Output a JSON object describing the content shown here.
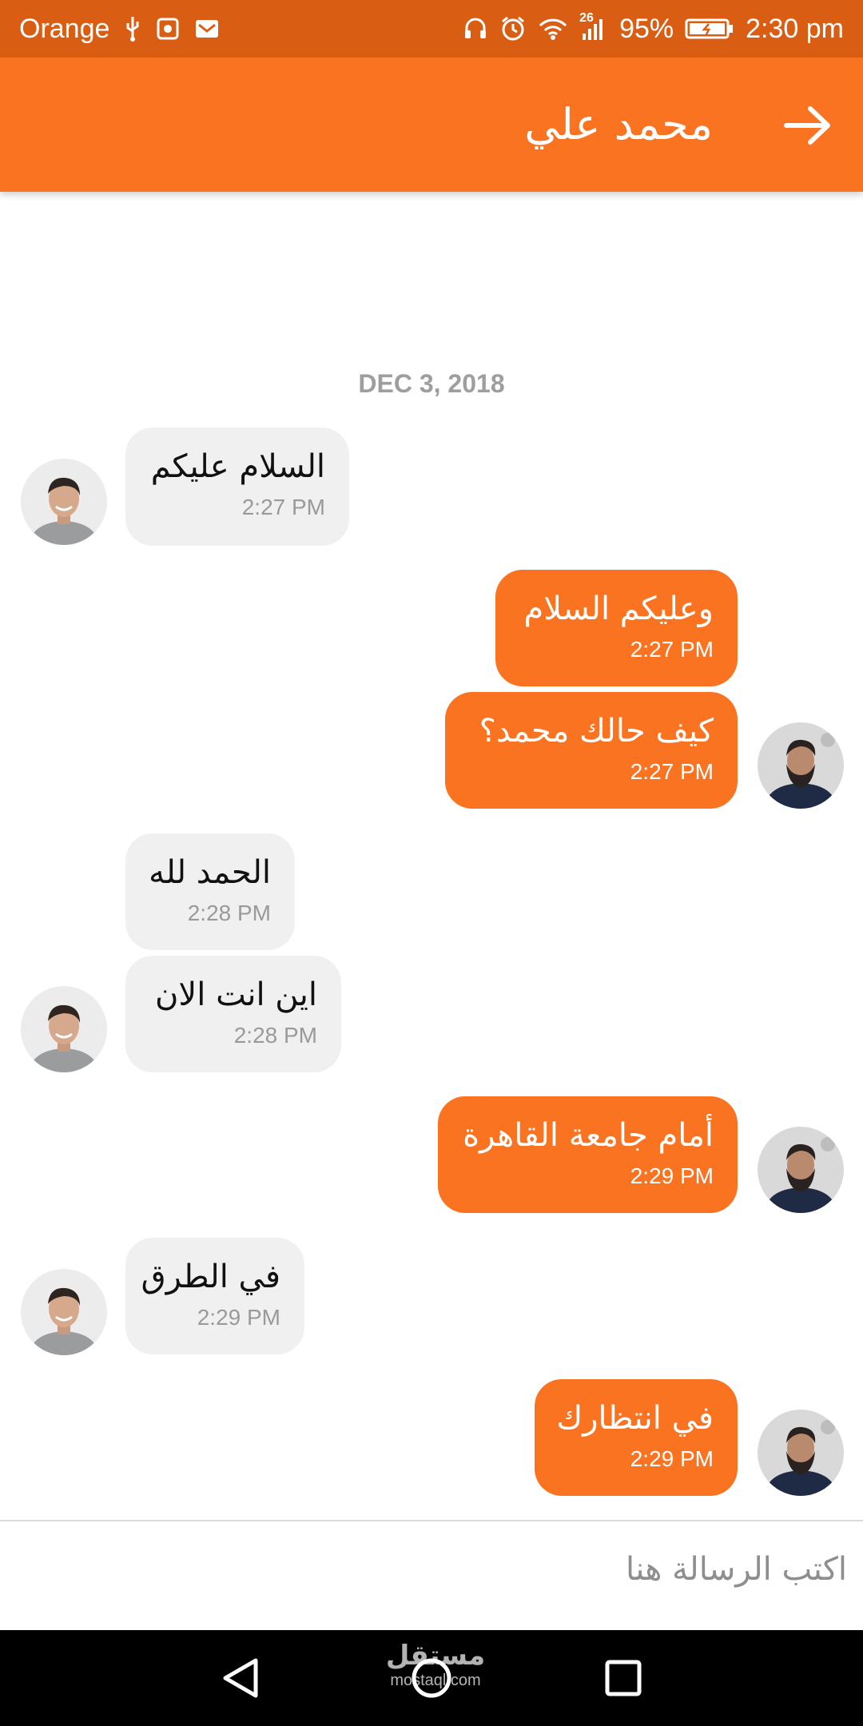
{
  "status_bar": {
    "carrier": "Orange",
    "network_label": "26",
    "battery": "95%",
    "time": "2:30 pm"
  },
  "header": {
    "contact_name": "محمد علي",
    "back_icon": "arrow-right-icon"
  },
  "conversation": {
    "date": "DEC 3, 2018",
    "messages": [
      {
        "direction": "incoming",
        "text": "السلام عليكم",
        "time": "2:27 PM"
      },
      {
        "direction": "outgoing",
        "text": "وعليكم السلام",
        "time": "2:27 PM"
      },
      {
        "direction": "outgoing",
        "text": "كيف حالك محمد؟",
        "time": "2:27 PM"
      },
      {
        "direction": "incoming",
        "text": "الحمد لله",
        "time": "2:28 PM"
      },
      {
        "direction": "incoming",
        "text": "اين انت الان",
        "time": "2:28 PM"
      },
      {
        "direction": "outgoing",
        "text": "أمام جامعة القاهرة",
        "time": "2:29 PM"
      },
      {
        "direction": "incoming",
        "text": "في الطرق",
        "time": "2:29 PM"
      },
      {
        "direction": "outgoing",
        "text": "في انتظارك",
        "time": "2:29 PM"
      }
    ]
  },
  "composer": {
    "placeholder": "اكتب الرسالة هنا",
    "value": ""
  },
  "watermark": {
    "arabic": "مستقل",
    "latin": "mostaql.com"
  },
  "colors": {
    "status_bar": "#d95e14",
    "app_bar": "#fa7320",
    "outgoing_bubble": "#fa7320",
    "incoming_bubble": "#f0f0f0",
    "date_text": "#9e9e9e",
    "nav_bar": "#000000"
  }
}
